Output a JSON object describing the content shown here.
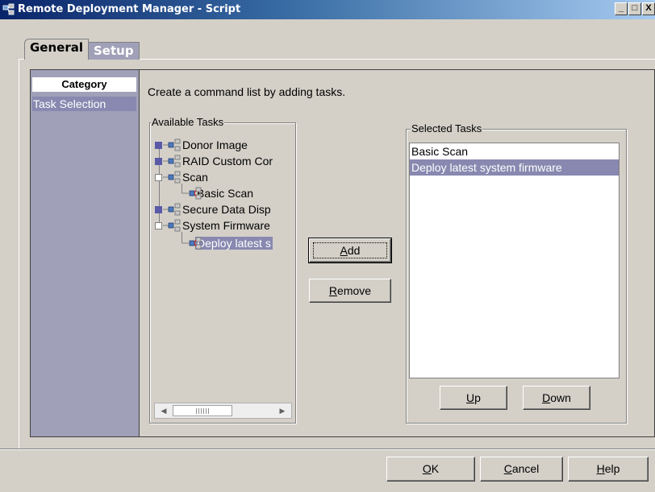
{
  "window": {
    "title": "Remote Deployment Manager - Script",
    "controls": {
      "minimize": "_",
      "maximize": "□",
      "close": "X"
    }
  },
  "tabs": [
    {
      "label": "General",
      "active": true
    },
    {
      "label": "Setup",
      "active": false
    }
  ],
  "category": {
    "header": "Category",
    "items": [
      {
        "label": "Task Selection",
        "selected": true
      }
    ]
  },
  "instructions": "Create a command list by adding tasks.",
  "available_tasks": {
    "label": "Available Tasks",
    "tree": [
      {
        "label": "Donor Image",
        "level": 0,
        "expander": "collapsed",
        "icon": "task-group-icon"
      },
      {
        "label": "RAID Custom Cor",
        "level": 0,
        "expander": "collapsed",
        "icon": "task-group-icon"
      },
      {
        "label": "Scan",
        "level": 0,
        "expander": "expanded",
        "icon": "task-group-icon"
      },
      {
        "label": "Basic Scan",
        "level": 1,
        "icon": "task-icon"
      },
      {
        "label": "Secure Data Disp",
        "level": 0,
        "expander": "collapsed",
        "icon": "task-group-icon"
      },
      {
        "label": "System Firmware",
        "level": 0,
        "expander": "expanded",
        "icon": "task-group-icon"
      },
      {
        "label": "Deploy latest s",
        "level": 1,
        "icon": "task-icon",
        "selected": true
      }
    ]
  },
  "buttons": {
    "add": {
      "mnemonic": "A",
      "rest": "dd"
    },
    "remove": {
      "mnemonic": "R",
      "rest": "emove"
    },
    "up": {
      "mnemonic": "U",
      "rest": "p"
    },
    "down": {
      "mnemonic": "D",
      "rest": "own"
    },
    "ok": {
      "mnemonic": "O",
      "rest": "K"
    },
    "cancel": {
      "mnemonic": "C",
      "rest": "ancel"
    },
    "help": {
      "mnemonic": "H",
      "rest": "elp"
    }
  },
  "selected_tasks": {
    "label": "Selected Tasks",
    "items": [
      {
        "label": "Basic Scan",
        "selected": false
      },
      {
        "label": "Deploy latest system firmware",
        "selected": true
      }
    ]
  },
  "colors": {
    "selection": "#8888b0",
    "category_panel": "#a0a0b8",
    "face": "#d4d0c8"
  }
}
